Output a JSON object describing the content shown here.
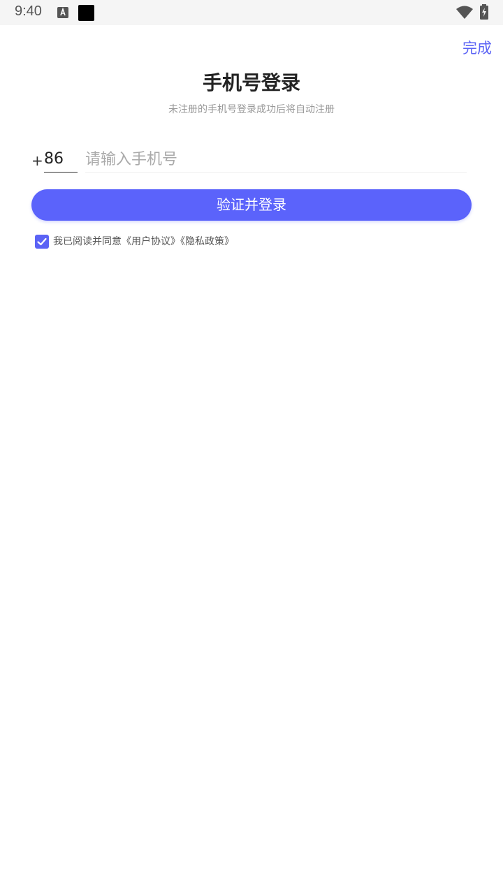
{
  "status_bar": {
    "time": "9:40",
    "icons": [
      "text-a-icon",
      "black-square-icon",
      "wifi-icon",
      "battery-charging-icon"
    ]
  },
  "header": {
    "done_label": "完成"
  },
  "main": {
    "title": "手机号登录",
    "subtitle": "未注册的手机号登录成功后将自动注册",
    "plus": "+",
    "country_code": "86",
    "phone_placeholder": "请输入手机号",
    "login_label": "验证并登录"
  },
  "agreement": {
    "checked": true,
    "prefix": "我已阅读并同意",
    "user_agreement": "《用户协议》",
    "privacy_policy": "《隐私政策》"
  },
  "colors": {
    "accent": "#5b63fb",
    "status_bar_bg": "#f5f5f5",
    "title_text": "#222222",
    "subtitle_text": "#999999"
  }
}
